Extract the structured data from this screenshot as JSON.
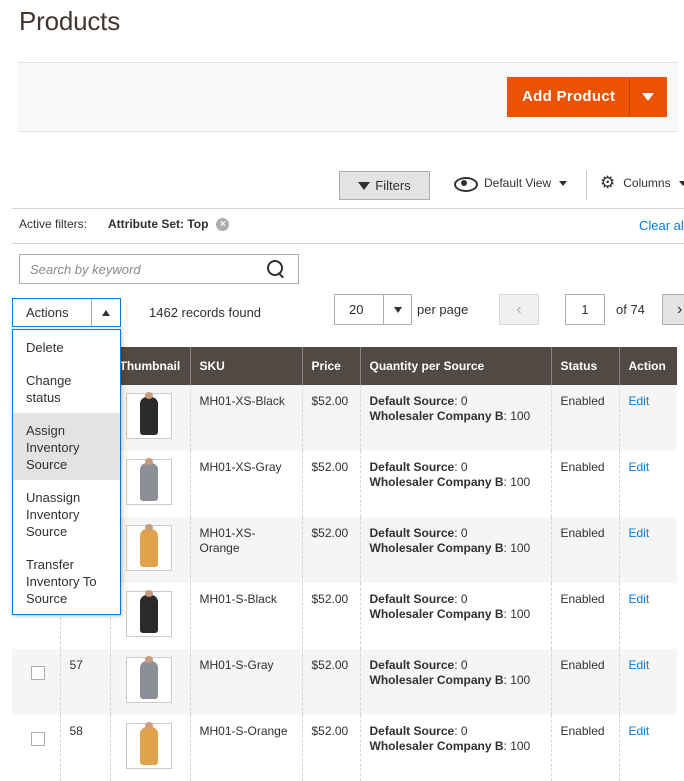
{
  "page": {
    "title": "Products"
  },
  "header": {
    "add_product_label": "Add Product"
  },
  "toolbar": {
    "filters_label": "Filters",
    "view_label": "Default View",
    "columns_label": "Columns"
  },
  "active_filters": {
    "label": "Active filters:",
    "value": "Attribute Set: Top",
    "clear_label": "Clear all"
  },
  "search": {
    "placeholder": "Search by keyword"
  },
  "mass_actions": {
    "label": "Actions",
    "options": [
      "Delete",
      "Change status",
      "Assign Inventory Source",
      "Unassign Inventory Source",
      "Transfer Inventory To Source"
    ],
    "hovered": "Assign Inventory Source"
  },
  "pagination": {
    "records_found": "1462 records found",
    "per_page_value": "20",
    "per_page_label": "per page",
    "current_page": "1",
    "of_pages": "of 74"
  },
  "grid": {
    "columns": [
      "Thumbnail",
      "SKU",
      "Price",
      "Quantity per Source",
      "Status",
      "Action"
    ],
    "source_a_label": "Default Source",
    "source_b_label": "Wholesaler Company B",
    "rows": [
      {
        "id": "",
        "sku": "MH01-XS-Black",
        "price": "$52.00",
        "qty_a": ": 0",
        "qty_b": ": 100",
        "status": "Enabled",
        "action": "Edit",
        "color": "#2a2a2a"
      },
      {
        "id": "",
        "sku": "MH01-XS-Gray",
        "price": "$52.00",
        "qty_a": ": 0",
        "qty_b": ": 100",
        "status": "Enabled",
        "action": "Edit",
        "color": "#8c8f96"
      },
      {
        "id": "",
        "sku": "MH01-XS-Orange",
        "price": "$52.00",
        "qty_a": ": 0",
        "qty_b": ": 100",
        "status": "Enabled",
        "action": "Edit",
        "color": "#e0a24a"
      },
      {
        "id": "",
        "sku": "MH01-S-Black",
        "price": "$52.00",
        "qty_a": ": 0",
        "qty_b": ": 100",
        "status": "Enabled",
        "action": "Edit",
        "color": "#2a2a2a"
      },
      {
        "id": "57",
        "sku": "MH01-S-Gray",
        "price": "$52.00",
        "qty_a": ": 0",
        "qty_b": ": 100",
        "status": "Enabled",
        "action": "Edit",
        "color": "#8c8f96"
      },
      {
        "id": "58",
        "sku": "MH01-S-Orange",
        "price": "$52.00",
        "qty_a": ": 0",
        "qty_b": ": 100",
        "status": "Enabled",
        "action": "Edit",
        "color": "#e0a24a"
      }
    ]
  },
  "colors": {
    "accent": "#eb5202",
    "link": "#007bdb",
    "header_bg": "#514943"
  }
}
